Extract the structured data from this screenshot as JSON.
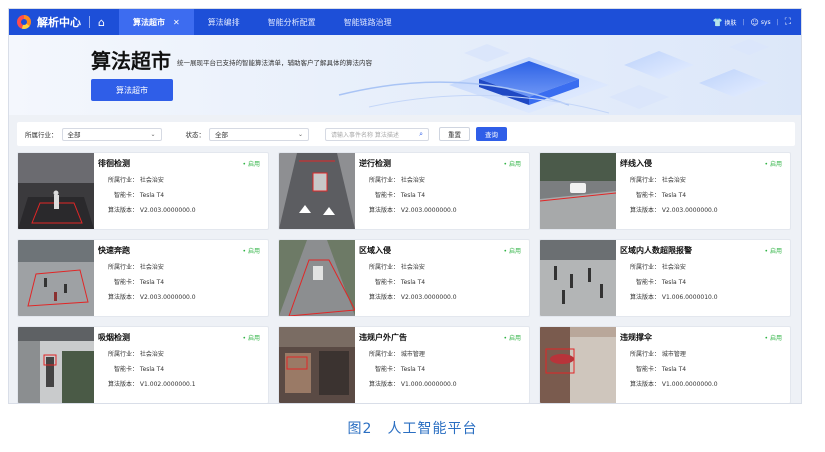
{
  "topbar": {
    "brand": "解析中心",
    "home_icon": "⌂",
    "tabs": [
      {
        "label": "算法超市",
        "active": true,
        "close": "✕"
      },
      {
        "label": "算法编排",
        "active": false
      },
      {
        "label": "智能分析配置",
        "active": false
      },
      {
        "label": "智能链路治理",
        "active": false
      }
    ],
    "skin_label": "换肤",
    "user_label": "sys",
    "fullscreen_icon": "⛶"
  },
  "banner": {
    "title": "算法超市",
    "subtitle": "统一展现平台已支持的智能算法清单，辅助客户了解具体的算法内容",
    "button": "算法超市"
  },
  "filter": {
    "industry_label": "所属行业：",
    "industry_value": "全部",
    "status_label": "状态：",
    "status_value": "全部",
    "search_placeholder": "请输入事件名称 算法描述",
    "reset": "重置",
    "query": "查询"
  },
  "fields": {
    "industry": "所属行业：",
    "card": "智能卡：",
    "version": "算法版本："
  },
  "cards": [
    {
      "name": "徘徊检测",
      "status": "• 启用",
      "industry": "社会治安",
      "card": "Tesla T4",
      "version": "V2.003.0000000.0"
    },
    {
      "name": "逆行检测",
      "status": "• 启用",
      "industry": "社会治安",
      "card": "Tesla T4",
      "version": "V2.003.0000000.0"
    },
    {
      "name": "绊线入侵",
      "status": "• 启用",
      "industry": "社会治安",
      "card": "Tesla T4",
      "version": "V2.003.0000000.0"
    },
    {
      "name": "快速奔跑",
      "status": "• 启用",
      "industry": "社会治安",
      "card": "Tesla T4",
      "version": "V2.003.0000000.0"
    },
    {
      "name": "区域入侵",
      "status": "• 启用",
      "industry": "社会治安",
      "card": "Tesla T4",
      "version": "V2.003.0000000.0"
    },
    {
      "name": "区域内人数超限报警",
      "status": "• 启用",
      "industry": "社会治安",
      "card": "Tesla T4",
      "version": "V1.006.0000010.0"
    },
    {
      "name": "吸烟检测",
      "status": "• 启用",
      "industry": "社会治安",
      "card": "Tesla T4",
      "version": "V1.002.0000000.1"
    },
    {
      "name": "违规户外广告",
      "status": "• 启用",
      "industry": "城市管理",
      "card": "Tesla T4",
      "version": "V1.000.0000000.0"
    },
    {
      "name": "违规撑伞",
      "status": "• 启用",
      "industry": "城市管理",
      "card": "Tesla T4",
      "version": "V1.000.0000000.0"
    }
  ],
  "caption": "图2　人工智能平台",
  "colors": {
    "primary": "#1d4fd8",
    "accent": "#2f5ee8",
    "status_green": "#2fb344"
  }
}
